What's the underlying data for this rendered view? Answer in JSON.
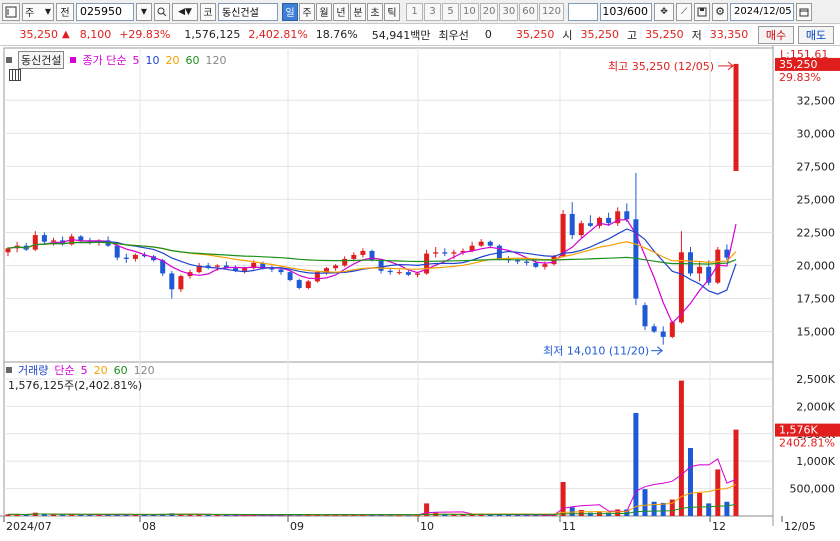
{
  "toolbar": {
    "market_label": "주",
    "prev_label": "전",
    "code": "025950",
    "gubun_label": "코",
    "stock_name": "동신건설",
    "periods": [
      "일",
      "주",
      "월",
      "년",
      "분",
      "초",
      "틱"
    ],
    "selected_period": "일",
    "intervals": [
      "1",
      "3",
      "5",
      "10",
      "20",
      "30",
      "60",
      "120"
    ],
    "count": "103/600",
    "date": "2024/12/05"
  },
  "quote": {
    "price": "35,250",
    "change": "8,100",
    "change_pct": "+29.83%",
    "volume": "1,576,125",
    "volume_pct": "2,402.81%",
    "turnover": "18.76%",
    "amount": "54,941백만",
    "priority_label": "최우선",
    "priority_value": "0",
    "ask_price": "35,250",
    "open_label": "시",
    "open": "35,250",
    "high_label": "고",
    "high": "35,250",
    "low_label": "저",
    "low": "33,350",
    "buy_label": "매수",
    "sell_label": "매도"
  },
  "price_panel": {
    "legend_name": "동신건설",
    "ma_type": "종가 단순",
    "ma_periods": [
      "5",
      "10",
      "20",
      "60",
      "120"
    ],
    "ma_colors": [
      "#d400d4",
      "#2044cc",
      "#f5a000",
      "#1b8f1b",
      "#999999"
    ],
    "max_note": "최고 35,250 (12/05)",
    "min_note": "최저 14,010 (11/20)",
    "right_top_label": "L:151.61",
    "current_tag": "35,250",
    "current_pct": "29.83%",
    "y_ticks": [
      "32,500",
      "30,000",
      "27,500",
      "25,000",
      "22,500",
      "20,000",
      "17,500",
      "15,000"
    ]
  },
  "volume_panel": {
    "legend_name": "거래량",
    "ma_type": "단순",
    "ma_periods": [
      "5",
      "20",
      "60",
      "120"
    ],
    "info": "1,576,125주(2,402.81%)",
    "current_tag": "1,576K",
    "current_pct": "2402.81%",
    "y_ticks": [
      "2,500K",
      "2,000K",
      "1,500K",
      "1,000K",
      "500,000"
    ]
  },
  "x_axis": [
    "2024/07",
    "08",
    "09",
    "10",
    "11",
    "12",
    "12/05"
  ],
  "colors": {
    "up": "#e01e1e",
    "down": "#1e5ad6",
    "accent": "#3d7fd6"
  },
  "chart_data": {
    "type": "candlestick",
    "price_range": [
      12700,
      36000
    ],
    "volume_range": [
      0,
      2700000
    ],
    "candles": [
      [
        21000,
        21400,
        20700,
        21300,
        30000
      ],
      [
        21300,
        21800,
        21000,
        21500,
        28000
      ],
      [
        21500,
        21700,
        21100,
        21200,
        26000
      ],
      [
        21200,
        22600,
        21100,
        22300,
        60000
      ],
      [
        22300,
        22500,
        21600,
        21800,
        35000
      ],
      [
        21800,
        22100,
        21500,
        21900,
        28000
      ],
      [
        21900,
        22200,
        21500,
        21600,
        26000
      ],
      [
        21600,
        22400,
        21500,
        22200,
        35000
      ],
      [
        22200,
        22300,
        21700,
        21900,
        24000
      ],
      [
        21900,
        22100,
        21600,
        21700,
        22000
      ],
      [
        21700,
        22000,
        21500,
        21900,
        24000
      ],
      [
        21900,
        22200,
        21400,
        21500,
        26000
      ],
      [
        21500,
        21600,
        20400,
        20600,
        35000
      ],
      [
        20600,
        20900,
        20200,
        20500,
        24000
      ],
      [
        20500,
        20900,
        20300,
        20800,
        23000
      ],
      [
        20800,
        21000,
        20600,
        20700,
        22000
      ],
      [
        20700,
        20800,
        20300,
        20400,
        20000
      ],
      [
        20400,
        20500,
        19200,
        19400,
        40000
      ],
      [
        19400,
        19600,
        17500,
        18200,
        50000
      ],
      [
        18200,
        19300,
        18000,
        19200,
        35000
      ],
      [
        19200,
        19700,
        19000,
        19500,
        25000
      ],
      [
        19500,
        20200,
        19400,
        20000,
        26000
      ],
      [
        20000,
        20200,
        19700,
        19900,
        20000
      ],
      [
        19900,
        20100,
        19600,
        20000,
        19000
      ],
      [
        20000,
        20300,
        19800,
        19800,
        19000
      ],
      [
        19800,
        20000,
        19500,
        19600,
        18000
      ],
      [
        19600,
        19900,
        19400,
        19800,
        17000
      ],
      [
        19800,
        20400,
        19700,
        20200,
        22000
      ],
      [
        20200,
        20300,
        19700,
        19800,
        18000
      ],
      [
        19800,
        20000,
        19500,
        19700,
        17000
      ],
      [
        19700,
        19900,
        19300,
        19500,
        17000
      ],
      [
        19500,
        19600,
        18800,
        18900,
        22000
      ],
      [
        18900,
        19000,
        18200,
        18300,
        28000
      ],
      [
        18300,
        18900,
        18200,
        18800,
        20000
      ],
      [
        18800,
        19600,
        18700,
        19500,
        24000
      ],
      [
        19500,
        19900,
        19300,
        19800,
        20000
      ],
      [
        19800,
        20100,
        19600,
        20000,
        18000
      ],
      [
        20000,
        20700,
        19900,
        20500,
        26000
      ],
      [
        20500,
        21000,
        20300,
        20800,
        24000
      ],
      [
        20800,
        21300,
        20600,
        21100,
        24000
      ],
      [
        21100,
        21200,
        20300,
        20400,
        22000
      ],
      [
        20400,
        20500,
        19400,
        19600,
        26000
      ],
      [
        19600,
        19800,
        19300,
        19500,
        18000
      ],
      [
        19500,
        19700,
        19300,
        19500,
        16000
      ],
      [
        19500,
        19600,
        19200,
        19300,
        15000
      ],
      [
        19300,
        19500,
        19100,
        19400,
        16000
      ],
      [
        19400,
        21200,
        19300,
        20900,
        230000
      ],
      [
        20900,
        21400,
        20600,
        21000,
        60000
      ],
      [
        21000,
        21300,
        20700,
        20900,
        35000
      ],
      [
        20900,
        21200,
        20500,
        21000,
        28000
      ],
      [
        21000,
        21300,
        20800,
        21100,
        25000
      ],
      [
        21100,
        21800,
        21000,
        21500,
        34000
      ],
      [
        21500,
        22000,
        21400,
        21800,
        30000
      ],
      [
        21800,
        21900,
        21300,
        21500,
        22000
      ],
      [
        21500,
        21600,
        20400,
        20500,
        35000
      ],
      [
        20500,
        20700,
        20200,
        20400,
        20000
      ],
      [
        20400,
        20600,
        20100,
        20300,
        18000
      ],
      [
        20300,
        20500,
        20000,
        20200,
        17000
      ],
      [
        20200,
        20400,
        19800,
        19900,
        17000
      ],
      [
        19900,
        20300,
        19700,
        20100,
        18000
      ],
      [
        20100,
        20800,
        20000,
        20700,
        22000
      ],
      [
        20700,
        24200,
        20600,
        23900,
        620000
      ],
      [
        23900,
        24800,
        22000,
        22300,
        160000
      ],
      [
        22300,
        23400,
        22100,
        23200,
        110000
      ],
      [
        23200,
        23800,
        22900,
        23000,
        60000
      ],
      [
        23000,
        23700,
        22800,
        23600,
        70000
      ],
      [
        23600,
        24000,
        23000,
        23200,
        60000
      ],
      [
        23200,
        24400,
        23000,
        24100,
        120000
      ],
      [
        24100,
        24700,
        23300,
        23500,
        120000
      ],
      [
        23500,
        27000,
        17000,
        17500,
        1880000
      ],
      [
        17000,
        17200,
        15100,
        15400,
        490000
      ],
      [
        15400,
        15600,
        14900,
        15000,
        260000
      ],
      [
        15000,
        15400,
        14010,
        14600,
        240000
      ],
      [
        14600,
        15800,
        14500,
        15700,
        300000
      ],
      [
        15700,
        22600,
        15600,
        21000,
        2470000
      ],
      [
        21000,
        21400,
        19200,
        19400,
        1240000
      ],
      [
        19400,
        20300,
        18800,
        19900,
        420000
      ],
      [
        19900,
        20400,
        18500,
        18700,
        230000
      ],
      [
        18700,
        21400,
        18600,
        21200,
        850000
      ],
      [
        21200,
        21600,
        20400,
        20600,
        260000
      ],
      [
        27150,
        35250,
        33350,
        35250,
        1576125
      ]
    ],
    "ma_series": [
      {
        "name": "5",
        "values": [
          15200,
          15000,
          15100,
          15600,
          16800,
          17300,
          18400,
          19500,
          20200,
          20700,
          24400
        ]
      },
      {
        "name": "10",
        "values": [
          19300,
          19000,
          18500,
          18100,
          17800,
          17400,
          17200,
          17500,
          18300,
          19300,
          21000
        ]
      },
      {
        "name": "20",
        "values": [
          20900,
          20800,
          20600,
          20500,
          20300,
          20100,
          19900,
          19800,
          19900,
          20100,
          20600
        ]
      }
    ]
  }
}
